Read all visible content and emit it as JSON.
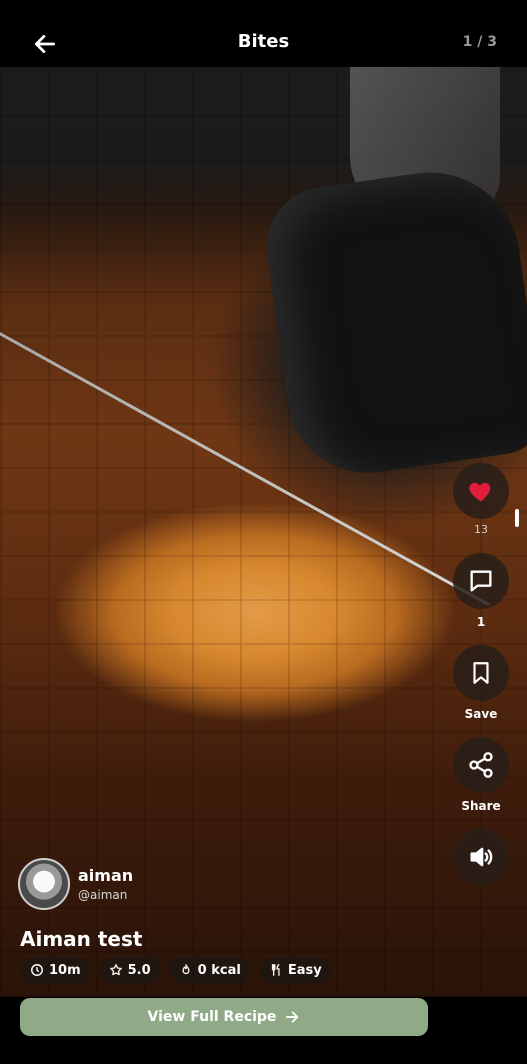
{
  "header": {
    "title": "Bites",
    "counter": "1 / 3",
    "back_icon": "arrow-left-icon"
  },
  "actions": {
    "like": {
      "icon": "heart-icon",
      "count": "13",
      "color": "#e11d3c"
    },
    "comment": {
      "icon": "comment-icon",
      "count": "1"
    },
    "save": {
      "icon": "bookmark-icon",
      "label": "Save"
    },
    "share": {
      "icon": "share-icon",
      "label": "Share"
    },
    "sound": {
      "icon": "volume-icon"
    }
  },
  "author": {
    "name": "aiman",
    "handle": "@aiman"
  },
  "recipe": {
    "title": "Aiman test",
    "time": "10m",
    "rating": "5.0",
    "calories": "0 kcal",
    "difficulty": "Easy"
  },
  "cta": {
    "label": "View Full Recipe",
    "color": "#90aa88"
  }
}
